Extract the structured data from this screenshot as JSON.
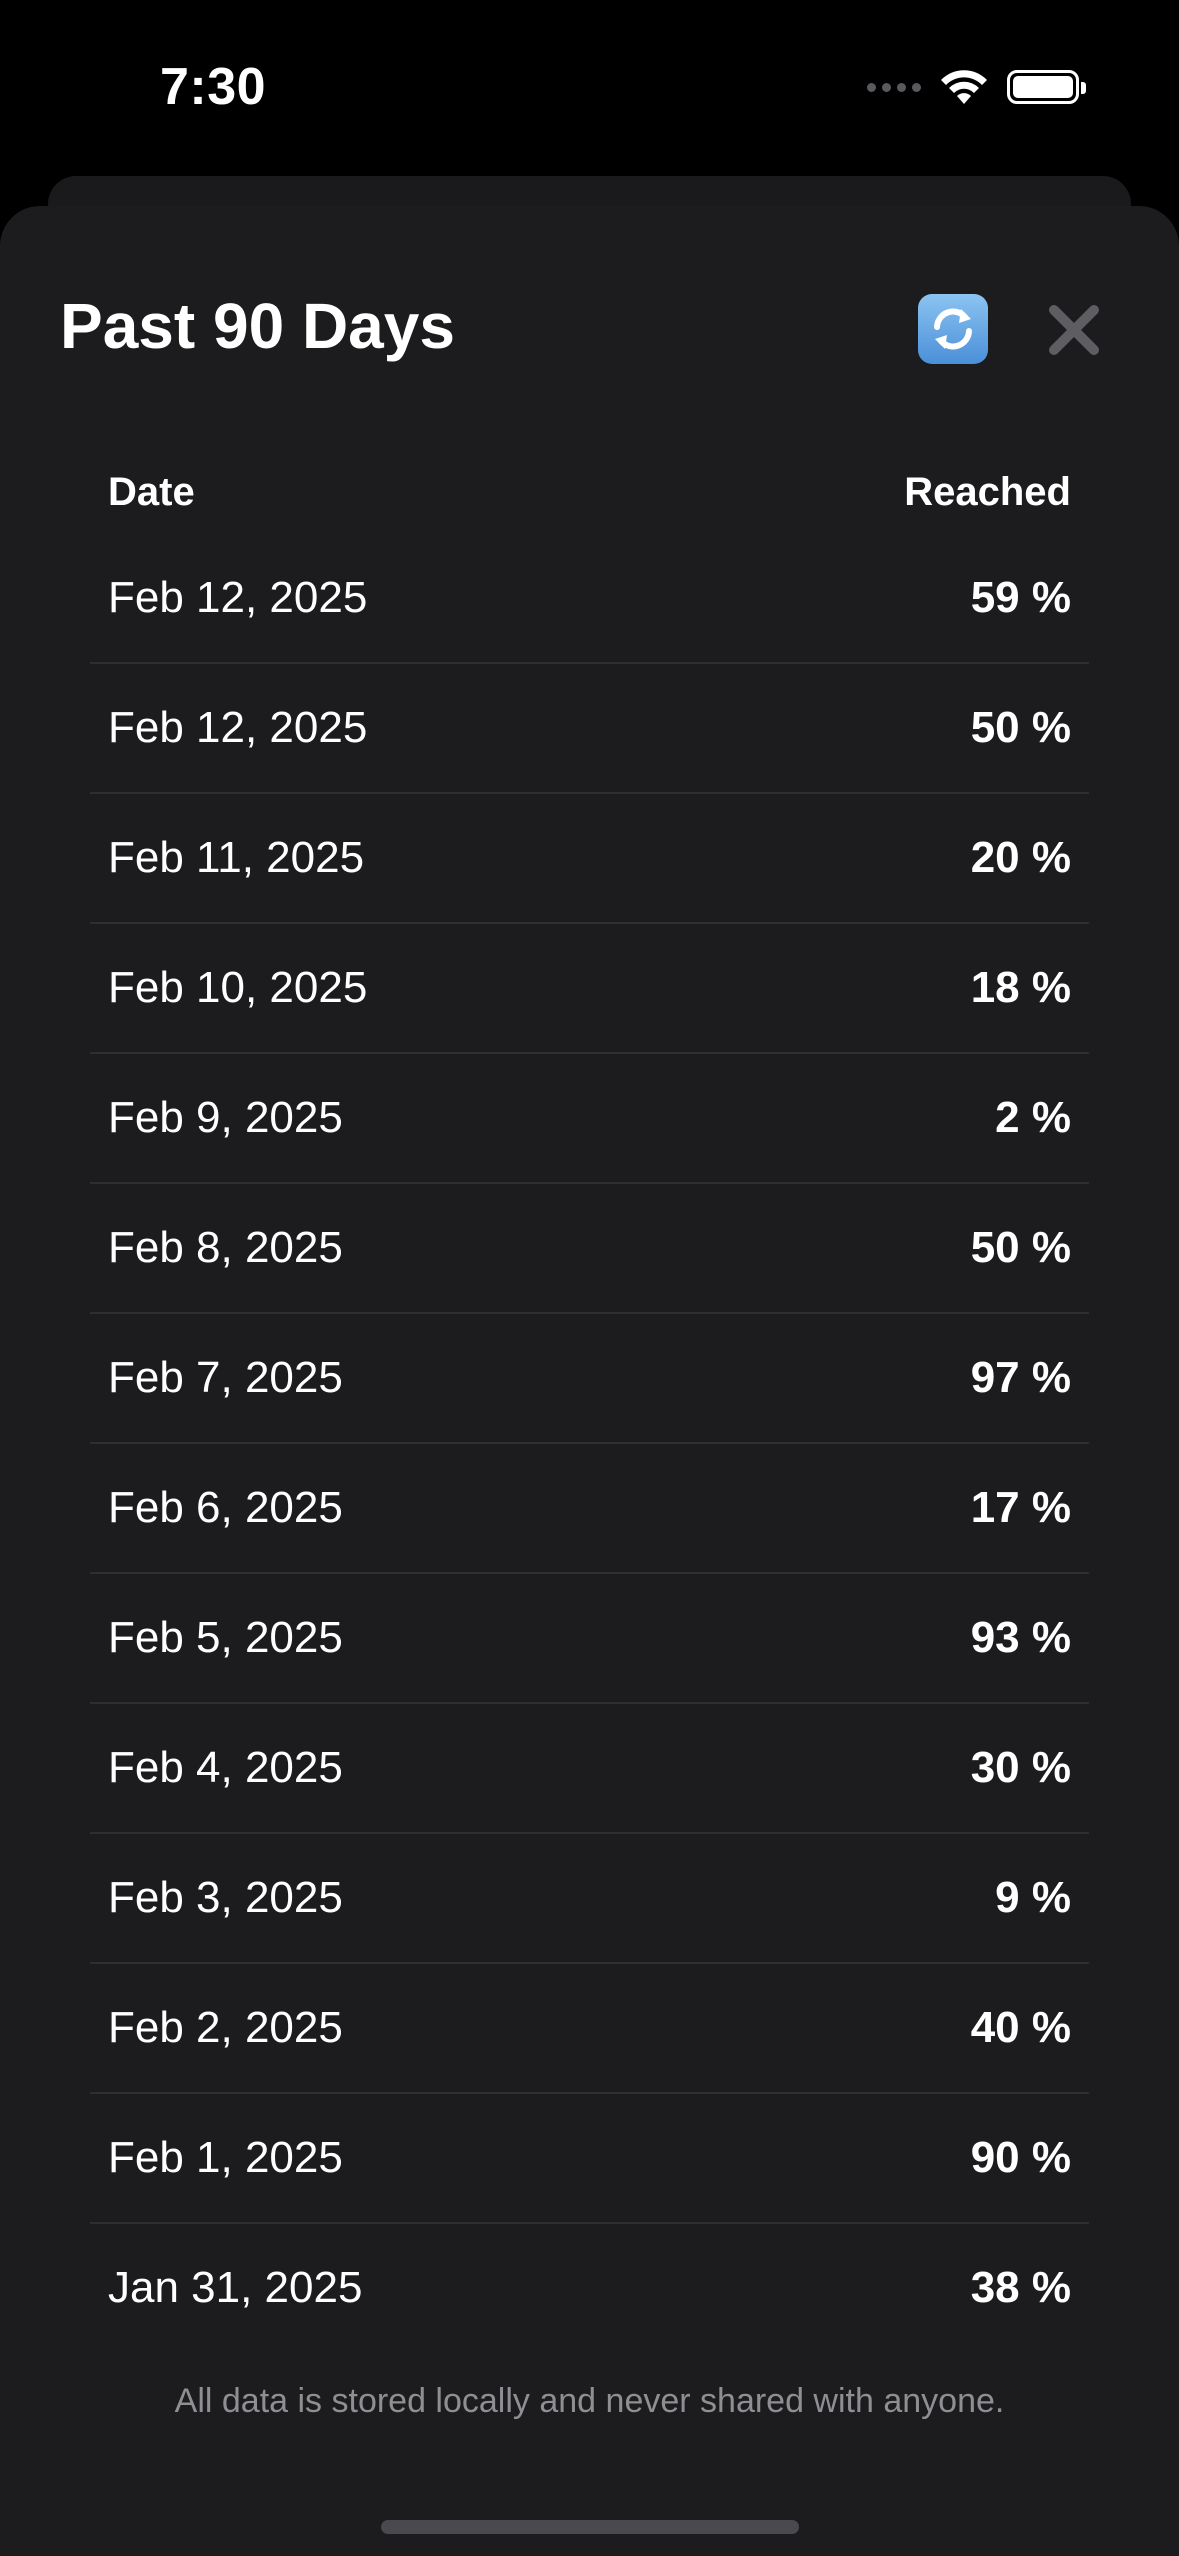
{
  "status_bar": {
    "time": "7:30"
  },
  "sheet": {
    "title": "Past 90 Days",
    "refresh_icon": "refresh-arrows-icon",
    "close_icon": "close-x-icon"
  },
  "table": {
    "headers": {
      "date": "Date",
      "reached": "Reached"
    },
    "rows": [
      {
        "date": "Feb 12, 2025",
        "reached": "59 %"
      },
      {
        "date": "Feb 12, 2025",
        "reached": "50 %"
      },
      {
        "date": "Feb 11, 2025",
        "reached": "20 %"
      },
      {
        "date": "Feb 10, 2025",
        "reached": "18 %"
      },
      {
        "date": "Feb 9, 2025",
        "reached": "2 %"
      },
      {
        "date": "Feb 8, 2025",
        "reached": "50 %"
      },
      {
        "date": "Feb 7, 2025",
        "reached": "97 %"
      },
      {
        "date": "Feb 6, 2025",
        "reached": "17 %"
      },
      {
        "date": "Feb 5, 2025",
        "reached": "93 %"
      },
      {
        "date": "Feb 4, 2025",
        "reached": "30 %"
      },
      {
        "date": "Feb 3, 2025",
        "reached": "9 %"
      },
      {
        "date": "Feb 2, 2025",
        "reached": "40 %"
      },
      {
        "date": "Feb 1, 2025",
        "reached": "90 %"
      },
      {
        "date": "Jan 31, 2025",
        "reached": "38 %"
      }
    ]
  },
  "footer": {
    "note": "All data is stored locally and never shared with anyone."
  },
  "colors": {
    "background": "#000000",
    "sheet": "#1c1c1e",
    "divider": "#2e2e31",
    "secondary_text": "#8e8e93"
  }
}
